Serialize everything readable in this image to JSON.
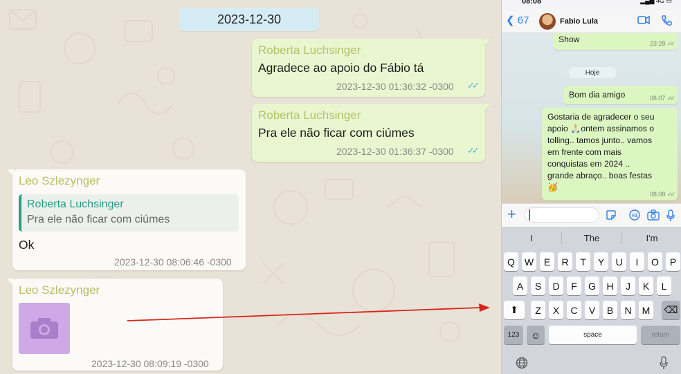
{
  "export": {
    "date": "2023-12-30",
    "messages": [
      {
        "direction": "out",
        "sender": "Roberta Luchsinger",
        "text": "Agradece ao apoio do Fábio tá",
        "timestamp": "2023-12-30 01:36:32 -0300"
      },
      {
        "direction": "out",
        "sender": "Roberta Luchsinger",
        "text": "Pra ele não ficar com ciúmes",
        "timestamp": "2023-12-30 01:36:37 -0300"
      },
      {
        "direction": "in",
        "sender": "Leo Szlezynger",
        "quote_sender": "Roberta Luchsinger",
        "quote_text": "Pra ele não ficar com ciúmes",
        "text": "Ok",
        "timestamp": "2023-12-30 08:06:46 -0300"
      },
      {
        "direction": "in",
        "sender": "Leo Szlezynger",
        "attachment": "camera-icon",
        "timestamp": "2023-12-30 08:09:19 -0300"
      }
    ]
  },
  "phone": {
    "status_time": "08:08",
    "status_right": "4G",
    "back_count": "67",
    "contact_name": "Fabio Lula",
    "day_label": "Hoje",
    "messages": [
      {
        "text": "Show",
        "time": "23:28"
      },
      {
        "text": "Bom dia amigo",
        "time": "08:07"
      },
      {
        "lines": [
          "Gostaria de agradecer o seu",
          "apoio 🙏🏻ontem assinamos o",
          "tolling.. tamos junto.. vamos",
          "em frente com mais",
          "conquistas em 2024 ..",
          "grande abraço.. boas festas",
          "🥳"
        ],
        "time": "08:08"
      }
    ],
    "keyboard": {
      "suggestions": [
        "I",
        "The",
        "I'm"
      ],
      "row1": [
        "Q",
        "W",
        "E",
        "R",
        "T",
        "Y",
        "U",
        "I",
        "O",
        "P"
      ],
      "row2": [
        "A",
        "S",
        "D",
        "F",
        "G",
        "H",
        "J",
        "K",
        "L"
      ],
      "row3": [
        "Z",
        "X",
        "C",
        "V",
        "B",
        "N",
        "M"
      ],
      "numbers_key": "123",
      "space_key": "space",
      "return_key": "return"
    }
  },
  "colors": {
    "outgoing_bubble": "#e8f7cf",
    "incoming_bubble": "#fbfaf6",
    "sender_name": "#b6c06a",
    "quote_accent": "#2a9d86",
    "read_ticks": "#5fa6e8",
    "annotation_arrow": "#d9231d",
    "ios_blue": "#2f7ee6"
  }
}
